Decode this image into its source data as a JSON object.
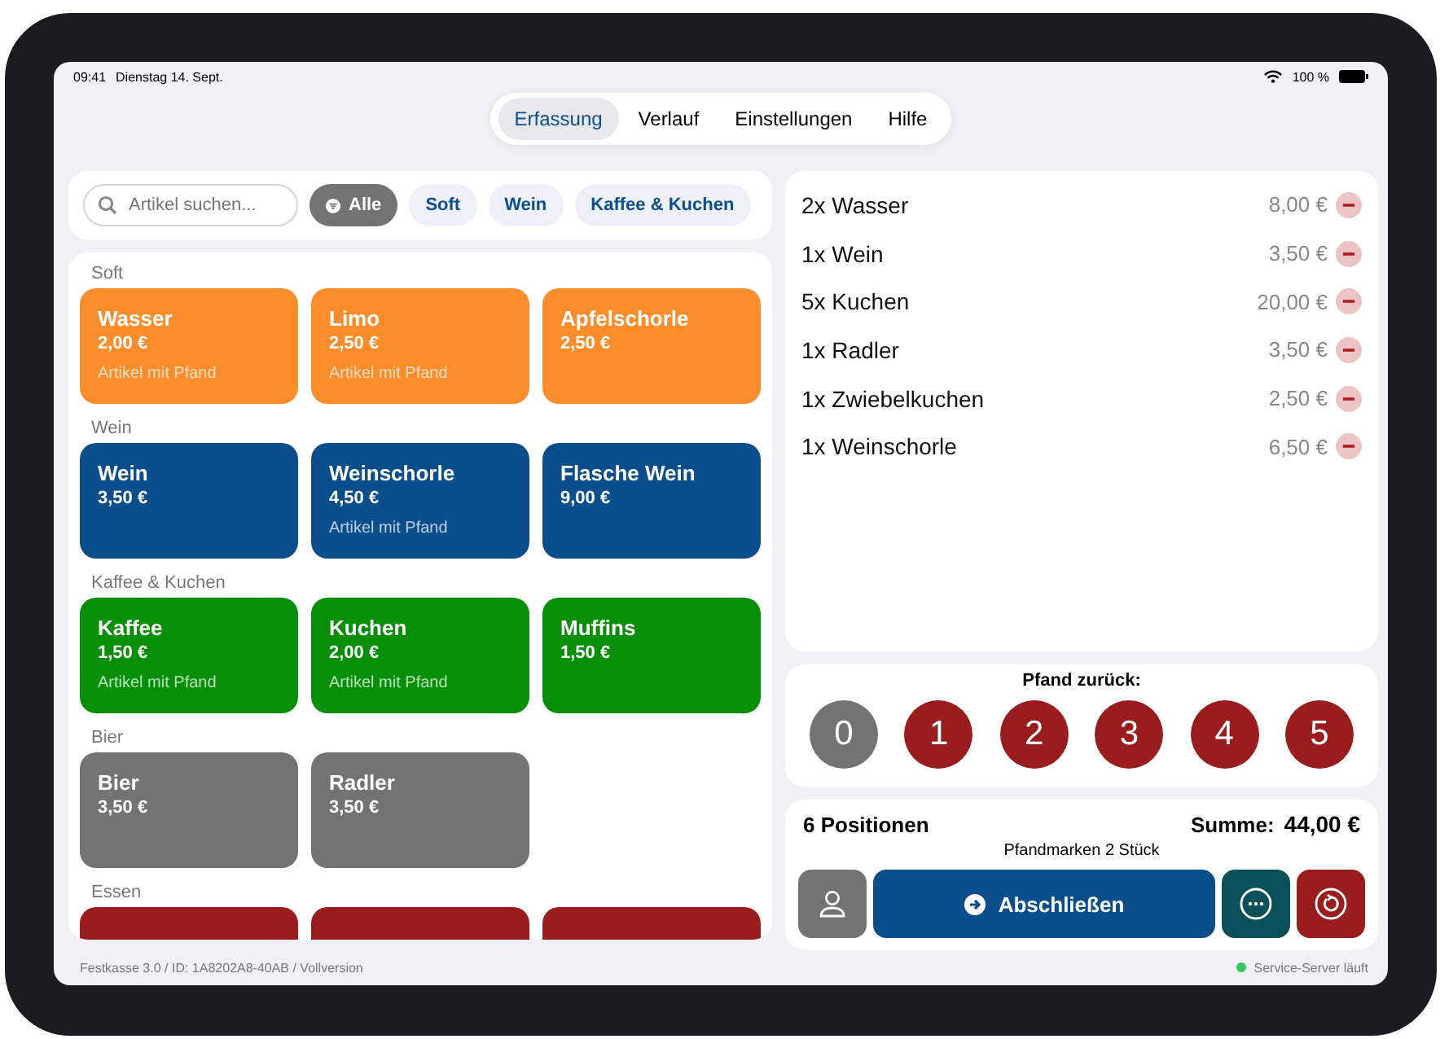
{
  "status_bar": {
    "time": "09:41",
    "date": "Dienstag 14. Sept.",
    "battery": "100 %"
  },
  "tabs": [
    {
      "label": "Erfassung",
      "selected": true
    },
    {
      "label": "Verlauf",
      "selected": false
    },
    {
      "label": "Einstellungen",
      "selected": false
    },
    {
      "label": "Hilfe",
      "selected": false
    }
  ],
  "search": {
    "placeholder": "Artikel suchen..."
  },
  "filters": [
    {
      "label": "Alle",
      "selected": true
    },
    {
      "label": "Soft",
      "selected": false
    },
    {
      "label": "Wein",
      "selected": false
    },
    {
      "label": "Kaffee & Kuchen",
      "selected": false
    }
  ],
  "categories": [
    {
      "name": "Soft",
      "color": "#fb8c2a",
      "products": [
        {
          "name": "Wasser",
          "price": "2,00 €",
          "note": "Artikel mit Pfand"
        },
        {
          "name": "Limo",
          "price": "2,50 €",
          "note": "Artikel mit Pfand"
        },
        {
          "name": "Apfelschorle",
          "price": "2,50 €"
        }
      ]
    },
    {
      "name": "Wein",
      "color": "#0a4f8c",
      "products": [
        {
          "name": "Wein",
          "price": "3,50 €"
        },
        {
          "name": "Weinschorle",
          "price": "4,50 €",
          "note": "Artikel mit Pfand"
        },
        {
          "name": "Flasche Wein",
          "price": "9,00 €"
        }
      ]
    },
    {
      "name": "Kaffee & Kuchen",
      "color": "#078f08",
      "products": [
        {
          "name": "Kaffee",
          "price": "1,50 €",
          "note": "Artikel mit Pfand"
        },
        {
          "name": "Kuchen",
          "price": "2,00 €",
          "note": "Artikel mit Pfand"
        },
        {
          "name": "Muffins",
          "price": "1,50 €"
        }
      ]
    },
    {
      "name": "Bier",
      "color": "#737373",
      "products": [
        {
          "name": "Bier",
          "price": "3,50 €"
        },
        {
          "name": "Radler",
          "price": "3,50 €"
        }
      ]
    },
    {
      "name": "Essen",
      "color": "#9b1c1c",
      "products": [
        {
          "kind": "cut_off"
        },
        {
          "kind": "cut_off"
        },
        {
          "kind": "cut_off"
        }
      ]
    }
  ],
  "order": [
    {
      "item": "2x Wasser",
      "amount": "8,00 €"
    },
    {
      "item": "1x Wein",
      "amount": "3,50 €"
    },
    {
      "item": "5x Kuchen",
      "amount": "20,00 €"
    },
    {
      "item": "1x Radler",
      "amount": "3,50 €"
    },
    {
      "item": "1x Zwiebelkuchen",
      "amount": "2,50 €"
    },
    {
      "item": "1x Weinschorle",
      "amount": "6,50 €"
    }
  ],
  "deposit_return": {
    "title": "Pfand zurück:",
    "options": [
      {
        "label": "0",
        "selected": true
      },
      {
        "label": "1",
        "selected": false
      },
      {
        "label": "2",
        "selected": false
      },
      {
        "label": "3",
        "selected": false
      },
      {
        "label": "4",
        "selected": false
      },
      {
        "label": "5",
        "selected": false
      }
    ]
  },
  "summary": {
    "positions": "6 Positionen",
    "total_label": "Summe:",
    "total": "44,00 €",
    "deposit_tokens": "Pfandmarken 2 Stück"
  },
  "checkout_button": "Abschließen",
  "footer": {
    "version": "Festkasse 3.0 / ID: 1A8202A8-40AB  / Vollversion",
    "server_status": "Service-Server läuft",
    "server_running": true
  }
}
